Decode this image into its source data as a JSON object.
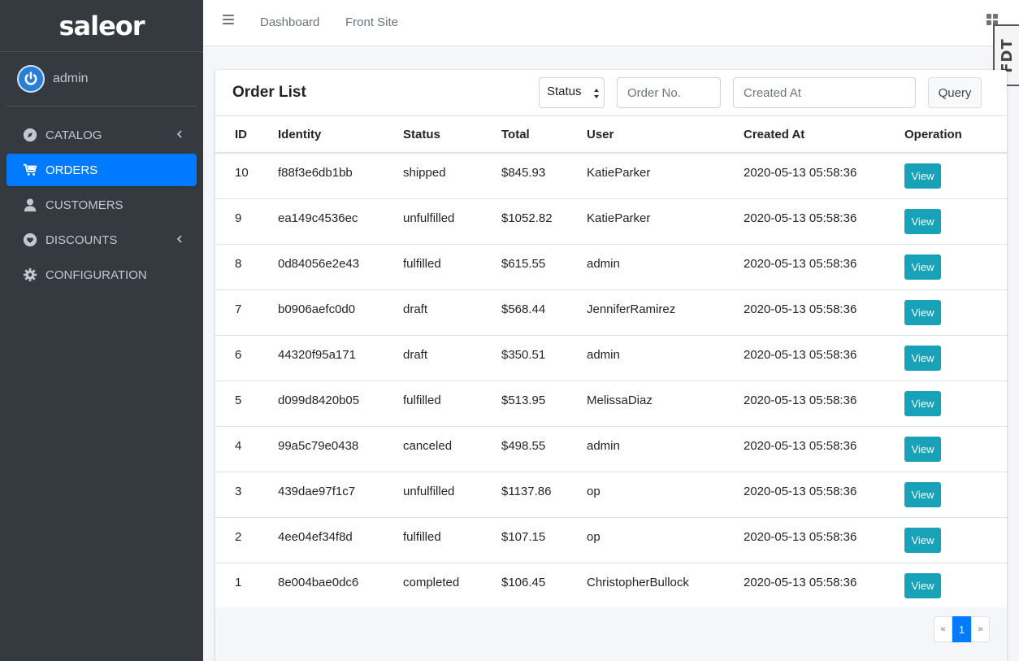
{
  "brand": {
    "name": "saleor"
  },
  "user": {
    "name": "admin"
  },
  "sidebar": {
    "items": [
      {
        "label": "CATALOG",
        "icon": "compass-icon",
        "has_children": true
      },
      {
        "label": "ORDERS",
        "icon": "cart-icon",
        "active": true
      },
      {
        "label": "CUSTOMERS",
        "icon": "user-icon"
      },
      {
        "label": "DISCOUNTS",
        "icon": "heart-icon",
        "has_children": true
      },
      {
        "label": "CONFIGURATION",
        "icon": "gear-icon"
      }
    ]
  },
  "topbar": {
    "links": [
      "Dashboard",
      "Front Site"
    ],
    "badge": "FDT"
  },
  "order_list": {
    "title": "Order List",
    "filters": {
      "status_label": "Status",
      "order_no_placeholder": "Order No.",
      "created_at_placeholder": "Created At",
      "query_label": "Query"
    },
    "columns": [
      "ID",
      "Identity",
      "Status",
      "Total",
      "User",
      "Created At",
      "Operation"
    ],
    "view_label": "View",
    "rows": [
      {
        "id": "10",
        "identity": "f88f3e6db1bb",
        "status": "shipped",
        "total": "$845.93",
        "user": "KatieParker",
        "created_at": "2020-05-13 05:58:36"
      },
      {
        "id": "9",
        "identity": "ea149c4536ec",
        "status": "unfulfilled",
        "total": "$1052.82",
        "user": "KatieParker",
        "created_at": "2020-05-13 05:58:36"
      },
      {
        "id": "8",
        "identity": "0d84056e2e43",
        "status": "fulfilled",
        "total": "$615.55",
        "user": "admin",
        "created_at": "2020-05-13 05:58:36"
      },
      {
        "id": "7",
        "identity": "b0906aefc0d0",
        "status": "draft",
        "total": "$568.44",
        "user": "JenniferRamirez",
        "created_at": "2020-05-13 05:58:36"
      },
      {
        "id": "6",
        "identity": "44320f95a171",
        "status": "draft",
        "total": "$350.51",
        "user": "admin",
        "created_at": "2020-05-13 05:58:36"
      },
      {
        "id": "5",
        "identity": "d099d8420b05",
        "status": "fulfilled",
        "total": "$513.95",
        "user": "MelissaDiaz",
        "created_at": "2020-05-13 05:58:36"
      },
      {
        "id": "4",
        "identity": "99a5c79e0438",
        "status": "canceled",
        "total": "$498.55",
        "user": "admin",
        "created_at": "2020-05-13 05:58:36"
      },
      {
        "id": "3",
        "identity": "439dae97f1c7",
        "status": "unfulfilled",
        "total": "$1137.86",
        "user": "op",
        "created_at": "2020-05-13 05:58:36"
      },
      {
        "id": "2",
        "identity": "4ee04ef34f8d",
        "status": "fulfilled",
        "total": "$107.15",
        "user": "op",
        "created_at": "2020-05-13 05:58:36"
      },
      {
        "id": "1",
        "identity": "8e004bae0dc6",
        "status": "completed",
        "total": "$106.45",
        "user": "ChristopherBullock",
        "created_at": "2020-05-13 05:58:36"
      }
    ],
    "pagination": {
      "prev": "«",
      "current": "1",
      "next": "»"
    }
  },
  "colors": {
    "sidebar_bg": "#343a40",
    "active": "#007bff",
    "view_button": "#17a2b8"
  }
}
